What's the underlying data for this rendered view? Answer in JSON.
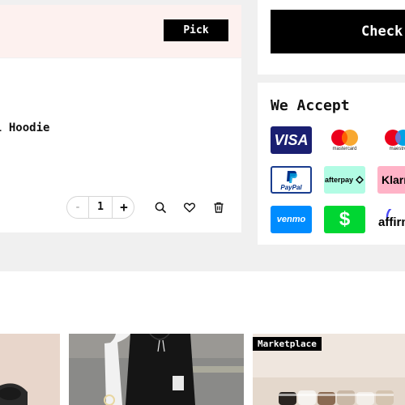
{
  "cart": {
    "pick_label": "Pick",
    "item_name": "l Hoodie",
    "quantity": "1",
    "minus_symbol": "-",
    "plus_symbol": "+"
  },
  "checkout": {
    "label": "Check"
  },
  "payments": {
    "title": "We Accept",
    "methods": [
      {
        "name": "VISA",
        "icon": "visa-icon"
      },
      {
        "name": "mastercard",
        "icon": "mastercard-icon"
      },
      {
        "name": "maestro",
        "icon": "maestro-icon"
      },
      {
        "name": "PayPal",
        "icon": "paypal-icon"
      },
      {
        "name": "afterpay",
        "icon": "afterpay-icon"
      },
      {
        "name": "Klarn",
        "icon": "klarna-icon"
      },
      {
        "name": "venmo",
        "icon": "venmo-icon"
      },
      {
        "name": "$",
        "icon": "cashapp-icon"
      },
      {
        "name": "affirm",
        "icon": "affirm-icon"
      }
    ]
  },
  "products": {
    "badge": "Marketplace"
  },
  "colors": {
    "pink_bar": "#fdf1ef",
    "black": "#000000",
    "visa_blue": "#1a1f71",
    "venmo_blue": "#008cff",
    "cashapp_green": "#00d632",
    "afterpay_mint": "#b2fce4",
    "klarna_pink": "#ffb3c7"
  }
}
